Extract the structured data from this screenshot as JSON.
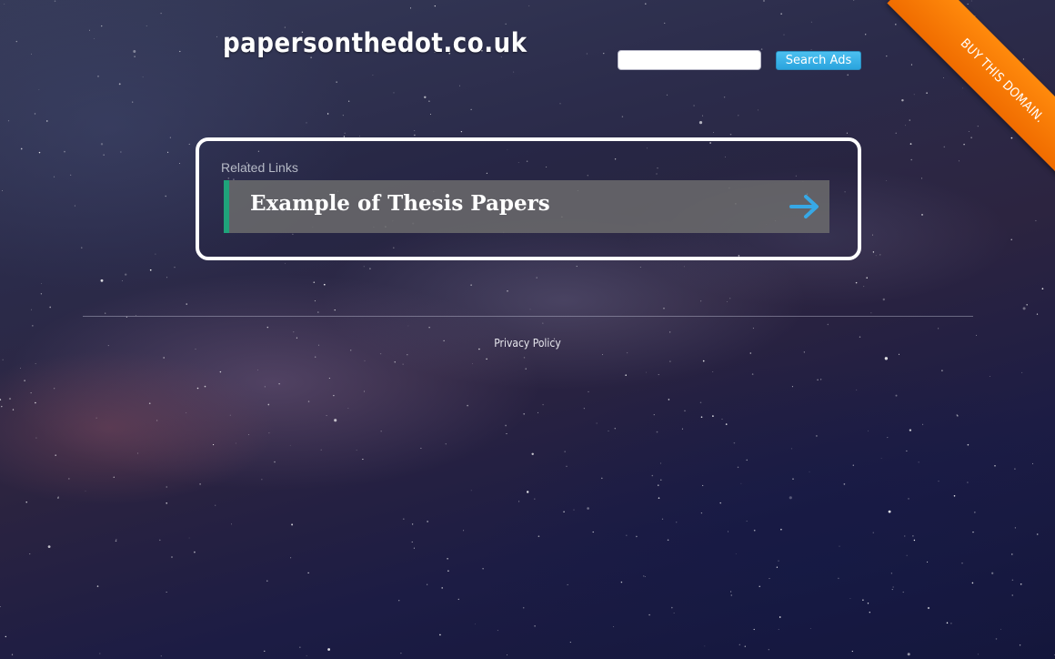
{
  "header": {
    "site_name": "papersonthedot.co.uk",
    "search": {
      "value": "",
      "placeholder": "",
      "button_label": "Search Ads"
    },
    "ribbon_label": "BUY THIS DOMAIN."
  },
  "related": {
    "heading": "Related Links",
    "links": [
      {
        "label": "Example of Thesis Papers",
        "icon": "arrow-right-icon"
      }
    ]
  },
  "footer": {
    "privacy_label": "Privacy Policy"
  },
  "colors": {
    "accent_blue": "#2aa4de",
    "ribbon_orange": "#f47b08",
    "link_border_green": "#1fa37a",
    "arrow_blue": "#37a8e6"
  }
}
